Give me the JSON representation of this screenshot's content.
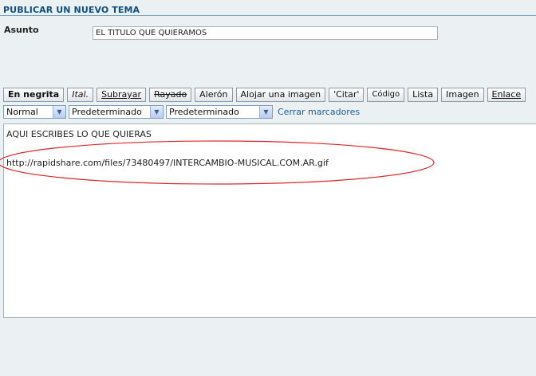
{
  "header": {
    "title": "PUBLICAR UN NUEVO TEMA"
  },
  "subject": {
    "label": "Asunto",
    "value": "EL TITULO QUE QUIERAMOS"
  },
  "toolbar": {
    "buttons": [
      {
        "label": "En negrita"
      },
      {
        "label": "Ital."
      },
      {
        "label": "Subrayar"
      },
      {
        "label": "Rayado"
      },
      {
        "label": "Alerón"
      },
      {
        "label": "Alojar una imagen"
      },
      {
        "label": "'Citar'"
      },
      {
        "label": "Código"
      },
      {
        "label": "Lista"
      },
      {
        "label": "Imagen"
      },
      {
        "label": "Enlace"
      }
    ]
  },
  "format": {
    "size_selected": "Normal",
    "color_selected": "Predeterminado",
    "font_selected": "Predeterminado",
    "close_tags": "Cerrar marcadores"
  },
  "editor": {
    "line1": "AQUI ESCRIBES LO QUE QUIERAS",
    "line2": "http://rapidshare.com/files/73480497/INTERCAMBIO-MUSICAL.COM.AR.gif"
  },
  "colors": {
    "header_text": "#0e4f80",
    "link": "#1b5c9a",
    "annotation": "#e0262b"
  }
}
